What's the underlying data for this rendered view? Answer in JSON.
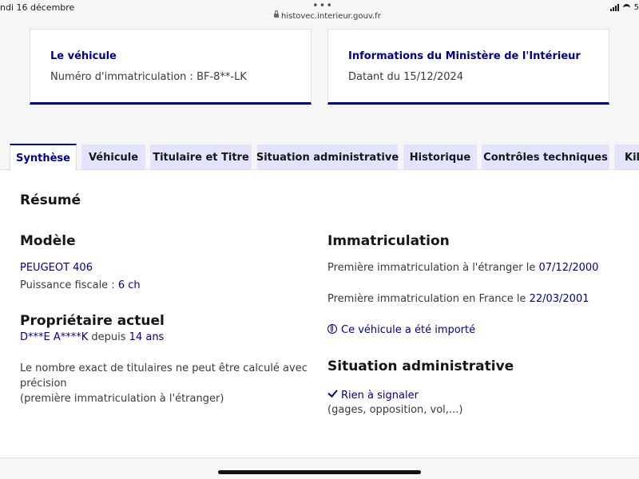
{
  "statusbar": {
    "date": "ndi 16 décembre",
    "dots": "•••",
    "url": "histovec.interieur.gouv.fr",
    "battery": "5"
  },
  "cards": {
    "vehicle": {
      "title": "Le véhicule",
      "text": "Numéro d'immatriculation : BF-8**-LK"
    },
    "ministry": {
      "title": "Informations du Ministère de l'Intérieur",
      "text": "Datant du 15/12/2024"
    }
  },
  "tabs": [
    "Synthèse",
    "Véhicule",
    "Titulaire et Titre",
    "Situation administrative",
    "Historique",
    "Contrôles techniques",
    "Kilo"
  ],
  "summary": {
    "title": "Résumé",
    "model": {
      "heading": "Modèle",
      "name": "PEUGEOT 406",
      "power_label": "Puissance fiscale : ",
      "power_value": "6 ch"
    },
    "owner": {
      "heading": "Propriétaire actuel",
      "name": "D***E A****K",
      "since_label": " depuis ",
      "since_value": "14 ans",
      "note_line1": "Le nombre exact de titulaires ne peut être calculé avec",
      "note_line2": "précision",
      "note_line3": "(première immatriculation à l'étranger)"
    },
    "registration": {
      "heading": "Immatriculation",
      "foreign_label": "Première immatriculation à l'étranger le ",
      "foreign_date": "07/12/2000",
      "france_label": "Première immatriculation en France le ",
      "france_date": "22/03/2001",
      "imported_link": "Ce véhicule a été importé"
    },
    "admin": {
      "heading": "Situation administrative",
      "status": "Rien à signaler",
      "details": "(gages, opposition, vol,...)"
    }
  }
}
